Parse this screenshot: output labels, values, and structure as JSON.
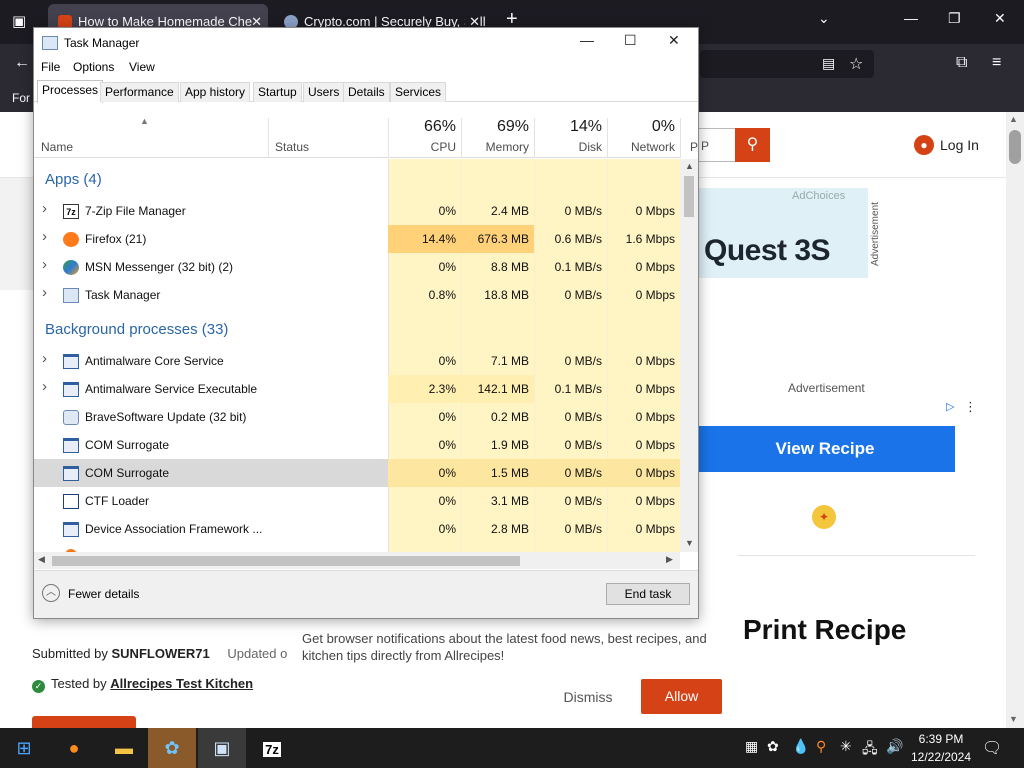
{
  "browser": {
    "tabs": [
      {
        "title": "How to Make Homemade Che",
        "active": true
      },
      {
        "title": "Crypto.com | Securely Buy, Sell",
        "active": false
      }
    ],
    "bookmarks_label": "For",
    "new_tab_symbol": "+"
  },
  "web": {
    "search_partial": "P",
    "login_label": "Log In",
    "ad": {
      "choices": "AdChoices",
      "headline": "Quest 3S",
      "side_label": "Advertisement"
    },
    "advertisement_label": "Advertisement",
    "view_recipe": "View Recipe",
    "print_recipe": "Print Recipe",
    "notification_text": "Get browser notifications about the latest food news, best recipes, and kitchen tips directly from Allrecipes!",
    "dismiss_label": "Dismiss",
    "allow_label": "Allow",
    "submitted_prefix": "Submitted by ",
    "submitted_user": "SUNFLOWER71",
    "updated_text": "Updated on",
    "tested_prefix": "Tested by ",
    "tested_by": "Allrecipes Test Kitchen"
  },
  "task_manager": {
    "title": "Task Manager",
    "menu": [
      "File",
      "Options",
      "View"
    ],
    "tabs": [
      "Processes",
      "Performance",
      "App history",
      "Startup",
      "Users",
      "Details",
      "Services"
    ],
    "active_tab": "Processes",
    "columns": {
      "name": "Name",
      "status": "Status",
      "cpu": {
        "pct": "66%",
        "label": "CPU"
      },
      "memory": {
        "pct": "69%",
        "label": "Memory"
      },
      "disk": {
        "pct": "14%",
        "label": "Disk"
      },
      "network": {
        "pct": "0%",
        "label": "Network"
      },
      "partial": "P"
    },
    "groups": [
      {
        "label": "Apps (4)",
        "rows": [
          {
            "name": "7-Zip File Manager",
            "icon": "7zip-icon",
            "expandable": true,
            "cpu": "0%",
            "memory": "2.4 MB",
            "disk": "0 MB/s",
            "network": "0 Mbps"
          },
          {
            "name": "Firefox (21)",
            "icon": "firefox-icon",
            "expandable": true,
            "cpu": "14.4%",
            "memory": "676.3 MB",
            "disk": "0.6 MB/s",
            "network": "1.6 Mbps"
          },
          {
            "name": "MSN Messenger (32 bit) (2)",
            "icon": "msn-messenger-icon",
            "expandable": true,
            "cpu": "0%",
            "memory": "8.8 MB",
            "disk": "0.1 MB/s",
            "network": "0 Mbps"
          },
          {
            "name": "Task Manager",
            "icon": "task-manager-icon",
            "expandable": true,
            "cpu": "0.8%",
            "memory": "18.8 MB",
            "disk": "0 MB/s",
            "network": "0 Mbps"
          }
        ]
      },
      {
        "label": "Background processes (33)",
        "rows": [
          {
            "name": "Antimalware Core Service",
            "icon": "service-window-icon",
            "expandable": true,
            "cpu": "0%",
            "memory": "7.1 MB",
            "disk": "0 MB/s",
            "network": "0 Mbps"
          },
          {
            "name": "Antimalware Service Executable",
            "icon": "service-window-icon",
            "expandable": true,
            "cpu": "2.3%",
            "memory": "142.1 MB",
            "disk": "0.1 MB/s",
            "network": "0 Mbps"
          },
          {
            "name": "BraveSoftware Update (32 bit)",
            "icon": "update-icon",
            "expandable": false,
            "cpu": "0%",
            "memory": "0.2 MB",
            "disk": "0 MB/s",
            "network": "0 Mbps"
          },
          {
            "name": "COM Surrogate",
            "icon": "service-window-icon",
            "expandable": false,
            "cpu": "0%",
            "memory": "1.9 MB",
            "disk": "0 MB/s",
            "network": "0 Mbps"
          },
          {
            "name": "COM Surrogate",
            "icon": "service-window-icon",
            "expandable": false,
            "selected": true,
            "cpu": "0%",
            "memory": "1.5 MB",
            "disk": "0 MB/s",
            "network": "0 Mbps"
          },
          {
            "name": "CTF Loader",
            "icon": "ctf-loader-icon",
            "expandable": false,
            "cpu": "0%",
            "memory": "3.1 MB",
            "disk": "0 MB/s",
            "network": "0 Mbps"
          },
          {
            "name": "Device Association Framework ...",
            "icon": "service-window-icon",
            "expandable": false,
            "cpu": "0%",
            "memory": "2.8 MB",
            "disk": "0 MB/s",
            "network": "0 Mbps"
          }
        ]
      }
    ],
    "fewer_details": "Fewer details",
    "end_task": "End task"
  },
  "taskbar": {
    "time": "6:39 PM",
    "date": "12/22/2024"
  }
}
